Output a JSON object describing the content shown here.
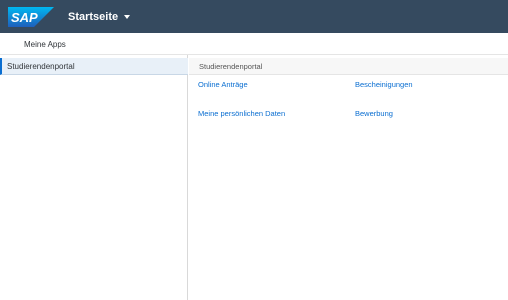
{
  "shell": {
    "logo_text": "SAP",
    "title": "Startseite",
    "brand_color": "#354a5f",
    "logo_color": "#0a6ed1"
  },
  "subheader": {
    "label": "Meine Apps"
  },
  "sidebar": {
    "items": [
      {
        "label": "Studierendenportal",
        "selected": true
      }
    ]
  },
  "content": {
    "section_title": "Studierendenportal",
    "links": [
      {
        "label": "Online Anträge"
      },
      {
        "label": "Bescheinigungen"
      },
      {
        "label": "Meine persönlichen Daten"
      },
      {
        "label": "Bewerbung"
      }
    ],
    "link_color": "#0a6ed1"
  }
}
